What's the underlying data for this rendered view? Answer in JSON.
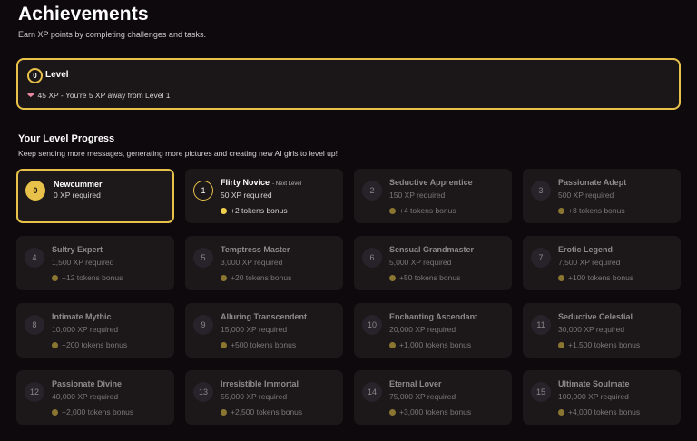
{
  "header": {
    "title": "Achievements",
    "subtitle": "Earn XP points by completing challenges and tasks."
  },
  "level_card": {
    "level_number": "0",
    "title": "Level",
    "xp_text": "45 XP - You're 5 XP away from Level 1",
    "icon": "heart-icon"
  },
  "progress": {
    "title": "Your Level Progress",
    "subtitle": "Keep sending more messages, generating more pictures and creating new AI girls to level up!",
    "next_tag": "- Next Level",
    "levels": [
      {
        "num": "0",
        "name": "Newcummer",
        "xp": "0 XP required",
        "bonus": ""
      },
      {
        "num": "1",
        "name": "Flirty Novice",
        "xp": "50 XP required",
        "bonus": "+2 tokens bonus"
      },
      {
        "num": "2",
        "name": "Seductive Apprentice",
        "xp": "150 XP required",
        "bonus": "+4 tokens bonus"
      },
      {
        "num": "3",
        "name": "Passionate Adept",
        "xp": "500 XP required",
        "bonus": "+8 tokens bonus"
      },
      {
        "num": "4",
        "name": "Sultry Expert",
        "xp": "1,500 XP required",
        "bonus": "+12 tokens bonus"
      },
      {
        "num": "5",
        "name": "Temptress Master",
        "xp": "3,000 XP required",
        "bonus": "+20 tokens bonus"
      },
      {
        "num": "6",
        "name": "Sensual Grandmaster",
        "xp": "5,000 XP required",
        "bonus": "+50 tokens bonus"
      },
      {
        "num": "7",
        "name": "Erotic Legend",
        "xp": "7,500 XP required",
        "bonus": "+100 tokens bonus"
      },
      {
        "num": "8",
        "name": "Intimate Mythic",
        "xp": "10,000 XP required",
        "bonus": "+200 tokens bonus"
      },
      {
        "num": "9",
        "name": "Alluring Transcendent",
        "xp": "15,000 XP required",
        "bonus": "+500 tokens bonus"
      },
      {
        "num": "10",
        "name": "Enchanting Ascendant",
        "xp": "20,000 XP required",
        "bonus": "+1,000 tokens bonus"
      },
      {
        "num": "11",
        "name": "Seductive Celestial",
        "xp": "30,000 XP required",
        "bonus": "+1,500 tokens bonus"
      },
      {
        "num": "12",
        "name": "Passionate Divine",
        "xp": "40,000 XP required",
        "bonus": "+2,000 tokens bonus"
      },
      {
        "num": "13",
        "name": "Irresistible Immortal",
        "xp": "55,000 XP required",
        "bonus": "+2,500 tokens bonus"
      },
      {
        "num": "14",
        "name": "Eternal Lover",
        "xp": "75,000 XP required",
        "bonus": "+3,000 tokens bonus"
      },
      {
        "num": "15",
        "name": "Ultimate Soulmate",
        "xp": "100,000 XP required",
        "bonus": "+4,000 tokens bonus"
      }
    ]
  },
  "colors": {
    "accent": "#e8c14a",
    "background": "#0e090c",
    "tile": "#1c1719",
    "muted_text": "#7c7679"
  }
}
